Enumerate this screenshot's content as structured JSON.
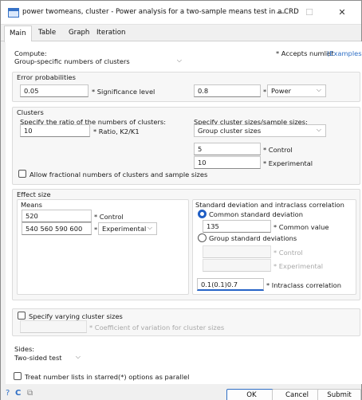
{
  "window": {
    "title": "power twomeans, cluster - Power analysis for a two-sample means test in a CRD",
    "minimize": "—",
    "maximize": "☐",
    "close": "✕"
  },
  "tabs": [
    "Main",
    "Table",
    "Graph",
    "Iteration"
  ],
  "compute": {
    "label": "Compute:",
    "value": "Group-specific numbers of clusters",
    "numlist_note": "* Accepts numlist",
    "examples_link": "(Examples)"
  },
  "error_probabilities": {
    "title": "Error probabilities",
    "significance_value": "0.05",
    "significance_label": "* Significance level",
    "power_value": "0.8",
    "power_prefix": "*",
    "power_select": "Power"
  },
  "clusters": {
    "title": "Clusters",
    "ratio_label": "Specify the ratio of the numbers of clusters:",
    "ratio_value": "10",
    "ratio_suffix": "* Ratio, K2/K1",
    "sizes_label": "Specify cluster sizes/sample sizes:",
    "sizes_select": "Group cluster sizes",
    "control_value": "5",
    "control_label": "* Control",
    "experimental_value": "10",
    "experimental_label": "* Experimental",
    "allow_fractional": "Allow fractional numbers of clusters and sample sizes"
  },
  "effect_size": {
    "title": "Effect size",
    "means_title": "Means",
    "control_mean": "520",
    "control_label": "* Control",
    "experimental_means": "540 560 590 600",
    "experimental_prefix": "*",
    "experimental_select": "Experimental",
    "sd_title": "Standard deviation and intraclass correlation",
    "common_sd_option": "Common standard deviation",
    "common_value": "135",
    "common_label": "* Common value",
    "group_sd_option": "Group standard deviations",
    "gsd_control_label": "* Control",
    "gsd_experimental_label": "* Experimental",
    "icc_value": "0.1(0.1)0.7",
    "icc_label": "* Intraclass correlation"
  },
  "varying": {
    "label": "Specify varying cluster sizes",
    "cv_label": "* Coefficient of variation for cluster sizes"
  },
  "sides": {
    "label": "Sides:",
    "value": "Two-sided test"
  },
  "parallel": {
    "label": "Treat number lists in starred(*) options as parallel"
  },
  "buttons": {
    "help": "?",
    "reset": "C",
    "copy": "⧉",
    "ok": "OK",
    "cancel": "Cancel",
    "submit": "Submit"
  },
  "colors": {
    "accent": "#1f5ec4",
    "link": "#2f6fc5"
  }
}
